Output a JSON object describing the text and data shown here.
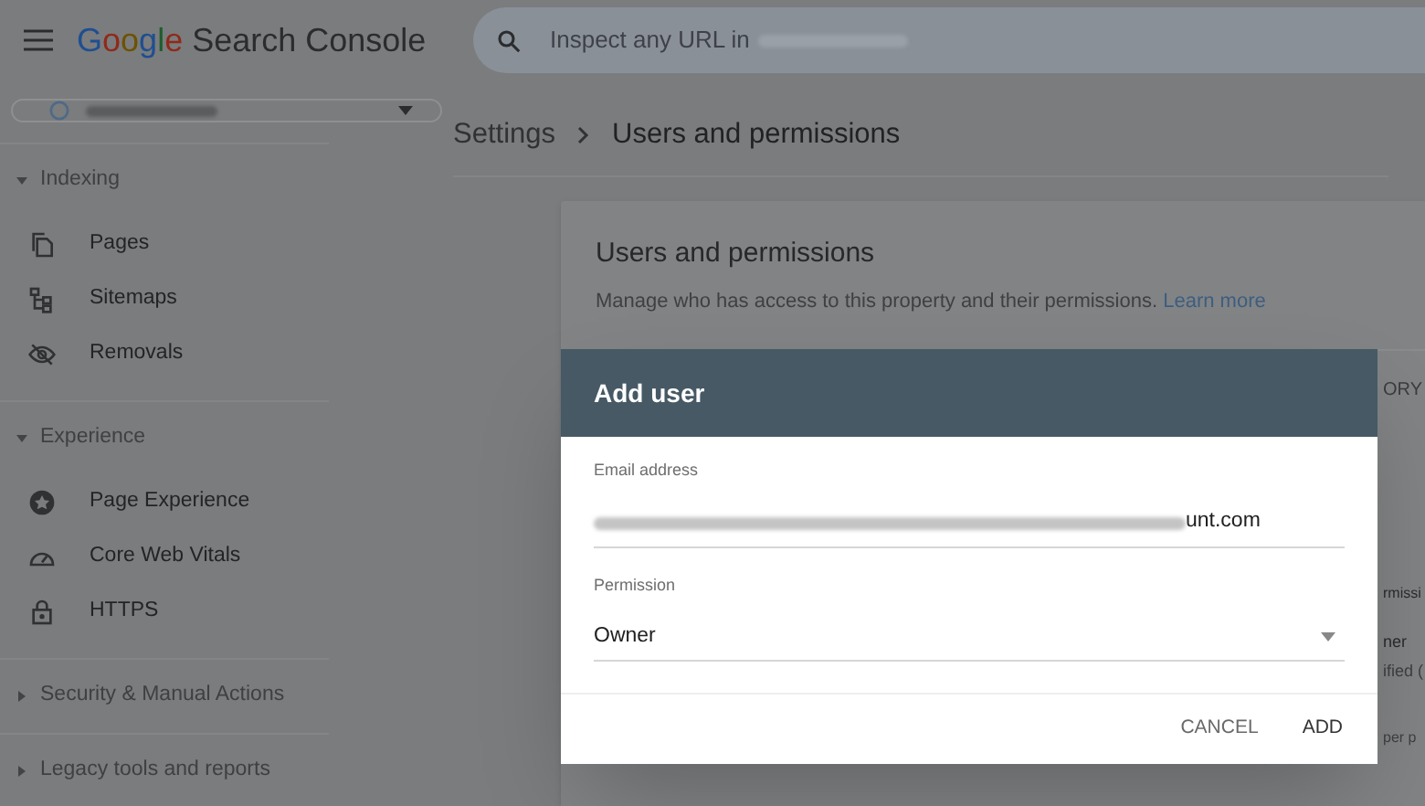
{
  "header": {
    "logo": "Google",
    "product": "Search Console",
    "search": {
      "placeholder": "Inspect any URL in"
    }
  },
  "sidebar": {
    "sections": [
      {
        "label": "Indexing",
        "expanded": true,
        "items": [
          {
            "label": "Pages"
          },
          {
            "label": "Sitemaps"
          },
          {
            "label": "Removals"
          }
        ]
      },
      {
        "label": "Experience",
        "expanded": true,
        "items": [
          {
            "label": "Page Experience"
          },
          {
            "label": "Core Web Vitals"
          },
          {
            "label": "HTTPS"
          }
        ]
      },
      {
        "label": "Security & Manual Actions",
        "expanded": false
      },
      {
        "label": "Legacy tools and reports",
        "expanded": false
      }
    ]
  },
  "breadcrumb": [
    "Settings",
    "Users and permissions"
  ],
  "card": {
    "title": "Users and permissions",
    "description": "Manage who has access to this property and their permissions.",
    "link": "Learn more",
    "toolbar_button_partial": "ORY",
    "column_header_partial": "rmissi",
    "row_line_1_partial": "ner",
    "row_line_2_partial": "ified (",
    "footer_partial": "per p"
  },
  "dialog": {
    "title": "Add user",
    "fields": [
      {
        "kind": "text",
        "label": "Email address",
        "value": "unt.com"
      },
      {
        "kind": "select",
        "label": "Permission",
        "value": "Owner"
      }
    ],
    "buttons": [
      "CANCEL",
      "ADD"
    ]
  }
}
